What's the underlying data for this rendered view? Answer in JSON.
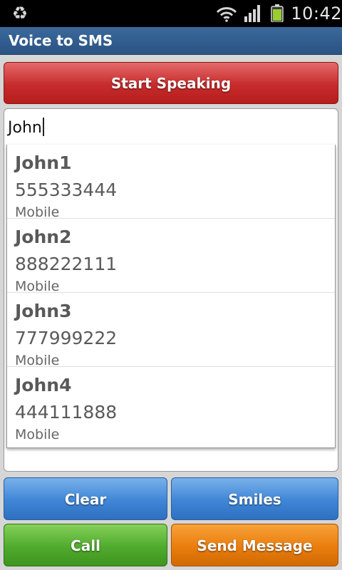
{
  "status_bar": {
    "time": "10:42",
    "icons": [
      "recycle-icon",
      "wifi-icon",
      "signal-icon",
      "battery-icon"
    ],
    "battery_color": "#9acd32"
  },
  "title_bar": {
    "title": "Voice to SMS"
  },
  "buttons": {
    "start_speaking": "Start Speaking",
    "clear": "Clear",
    "smiles": "Smiles",
    "call": "Call",
    "send_message": "Send Message"
  },
  "recipient_input": {
    "value": "John"
  },
  "suggestions": [
    {
      "name": "John1",
      "number": "555333444",
      "type": "Mobile"
    },
    {
      "name": "John2",
      "number": "888222111",
      "type": "Mobile"
    },
    {
      "name": "John3",
      "number": "777999222",
      "type": "Mobile"
    },
    {
      "name": "John4",
      "number": "444111888",
      "type": "Mobile"
    }
  ],
  "colors": {
    "title_bar": "#2f5a8d",
    "start_button": "#c72b2b",
    "blue_button": "#3f86d6",
    "call_button": "#4fab2d",
    "send_button": "#ea7d0d"
  }
}
